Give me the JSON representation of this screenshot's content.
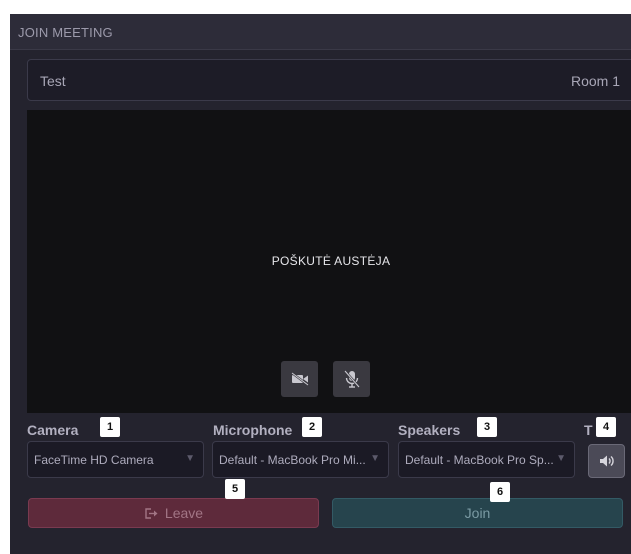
{
  "header": {
    "title": "JOIN MEETING"
  },
  "meeting": {
    "name": "Test",
    "room": "Room 1"
  },
  "video": {
    "participant": "POŠKUTĖ AUSTĖJA"
  },
  "devices": {
    "camera": {
      "label": "Camera",
      "value": "FaceTime HD Camera"
    },
    "microphone": {
      "label": "Microphone",
      "value": "Default - MacBook Pro Mi..."
    },
    "speakers": {
      "label": "Speakers",
      "value": "Default - MacBook Pro Sp..."
    },
    "test": {
      "label": "T"
    }
  },
  "actions": {
    "leave_label": "Leave",
    "join_label": "Join"
  },
  "badges": [
    "1",
    "2",
    "3",
    "4",
    "5",
    "6"
  ],
  "colors": {
    "leave": "#5e2a3b",
    "join": "#26444d",
    "background": "#24232e"
  },
  "icons": [
    "camera-off-icon",
    "mic-off-icon",
    "speaker-icon",
    "exit-icon",
    "dropdown-arrow-icon"
  ]
}
